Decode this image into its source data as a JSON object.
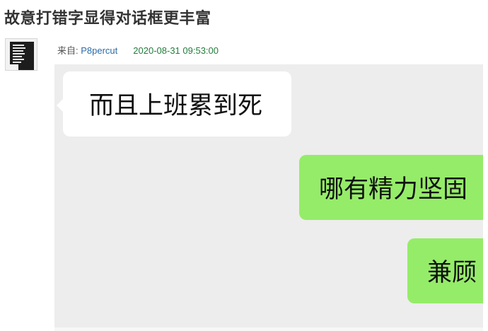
{
  "post": {
    "title": "故意打错字显得对话框更丰富",
    "meta_prefix": "来自: ",
    "author": "P8percut",
    "timestamp": "2020-08-31 09:53:00"
  },
  "chat": {
    "background": "#ededed",
    "incoming_color": "#ffffff",
    "outgoing_color": "#95ec69",
    "messages": [
      {
        "side": "left",
        "text": "而且上班累到死"
      },
      {
        "side": "right",
        "text": "哪有精力坚固"
      },
      {
        "side": "right",
        "text": "兼顾"
      }
    ]
  },
  "colors": {
    "title": "#333333",
    "author": "#2b6ba6",
    "timestamp": "#217d3a"
  }
}
